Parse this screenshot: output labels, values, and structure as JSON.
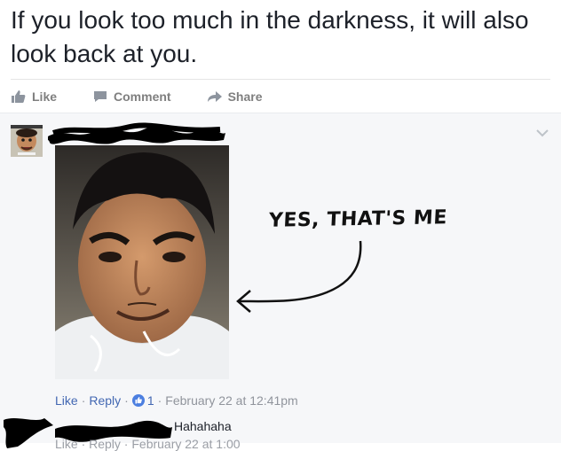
{
  "post": {
    "text": "If you look too much in the darkness, it will also look back at you."
  },
  "actions": {
    "like": "Like",
    "comment": "Comment",
    "share": "Share"
  },
  "comment": {
    "annotation": "YES, THAT'S ME",
    "meta": {
      "like": "Like",
      "reply": "Reply",
      "like_count": "1",
      "timestamp": "February 22 at 12:41pm"
    }
  },
  "reply": {
    "text": "Hahahaha",
    "meta_partial": "Like · Reply · February 22 at 1:00"
  },
  "colors": {
    "link": "#4267b2",
    "muted": "#90949c",
    "comment_bg": "#f6f7f9"
  }
}
